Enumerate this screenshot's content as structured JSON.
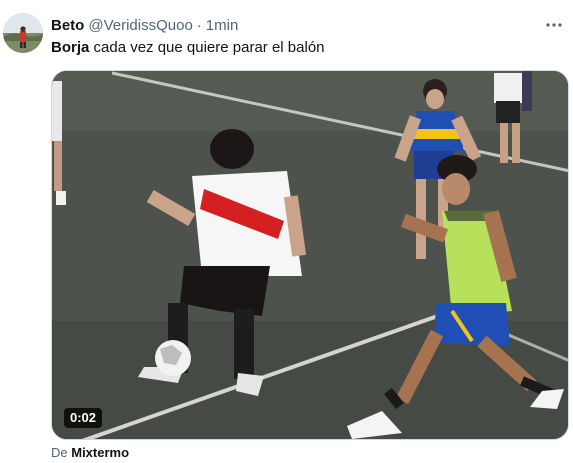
{
  "tweet": {
    "display_name": "Beto",
    "handle": "@VeridissQuoo",
    "separator": "·",
    "time": "1min",
    "text_mention": "Borja",
    "text_rest": " cada vez que quiere parar el balón",
    "video": {
      "duration": "0:02"
    },
    "source_prefix": "De ",
    "source_name": "Mixtermo"
  },
  "colors": {
    "text_primary": "#0f1419",
    "text_secondary": "#536471",
    "turf": "#4a4f4a",
    "boca_blue": "#1f4fb5",
    "boca_yellow": "#f2c318",
    "river_red": "#d42020",
    "bib_green": "#b8e05a"
  },
  "icons": {
    "more": "more-dots-icon"
  }
}
